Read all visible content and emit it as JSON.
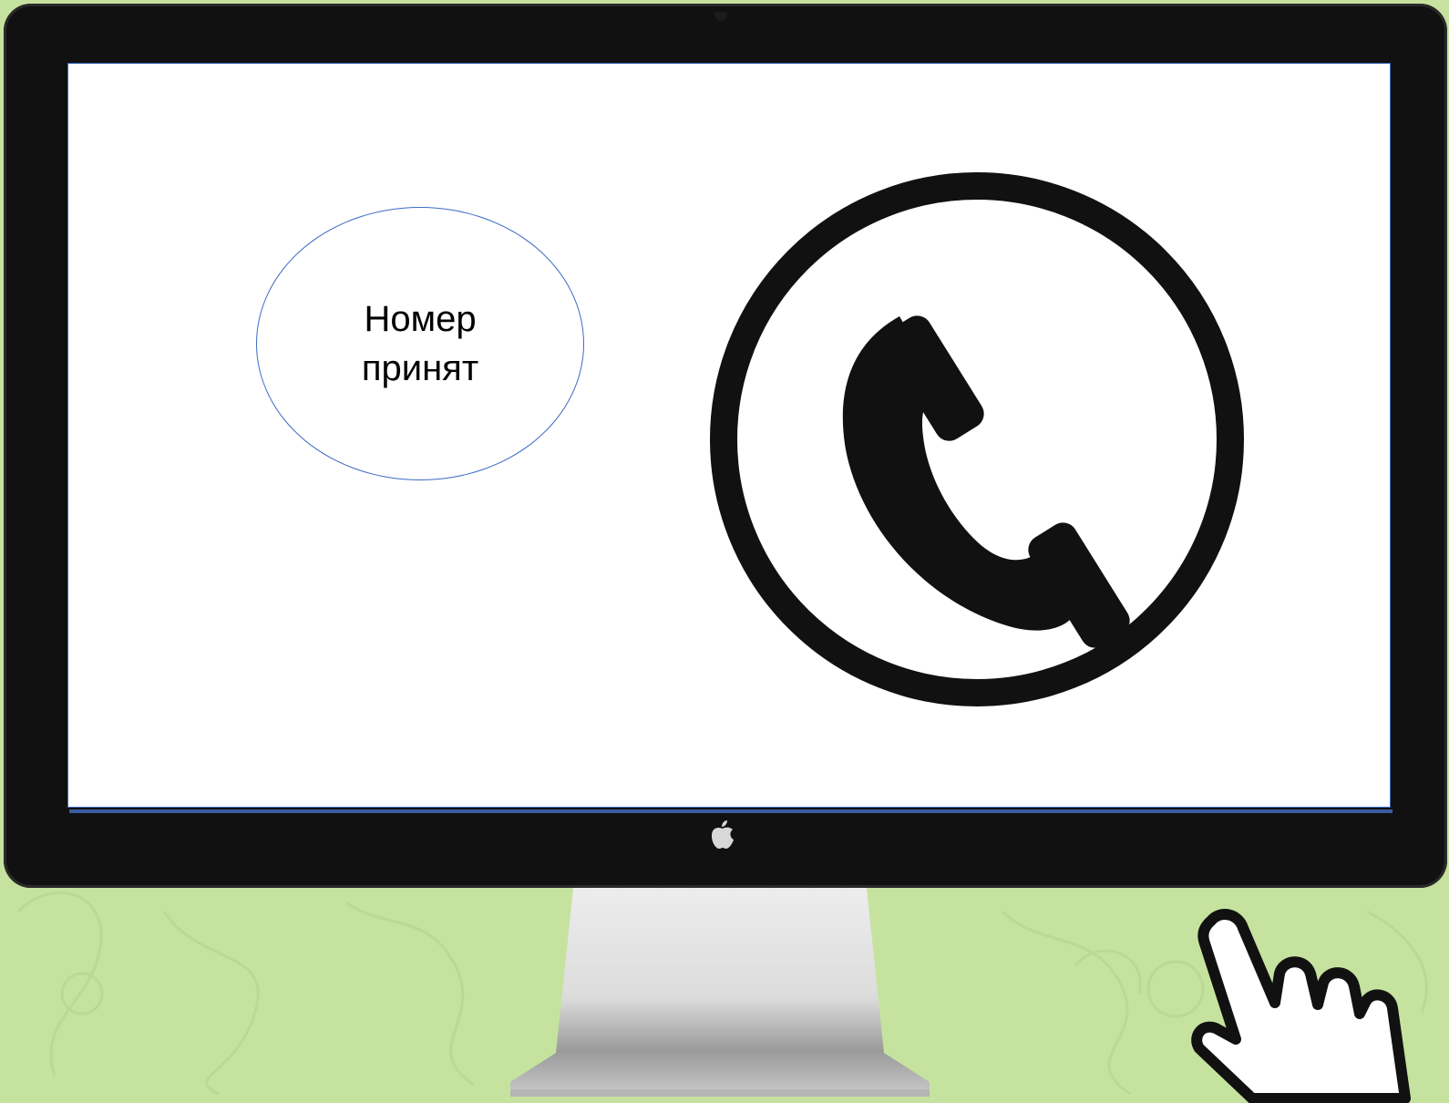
{
  "status": {
    "text": "Номер принят"
  },
  "icons": {
    "call": "phone-handset-circle-icon",
    "logo": "apple-logo-icon",
    "pointer": "pointing-hand-icon",
    "camera": "camera-icon"
  },
  "colors": {
    "background": "#c5e29f",
    "bezel": "#111111",
    "screen": "#ffffff",
    "accent_border": "#3c6bc4",
    "icon": "#111111"
  }
}
